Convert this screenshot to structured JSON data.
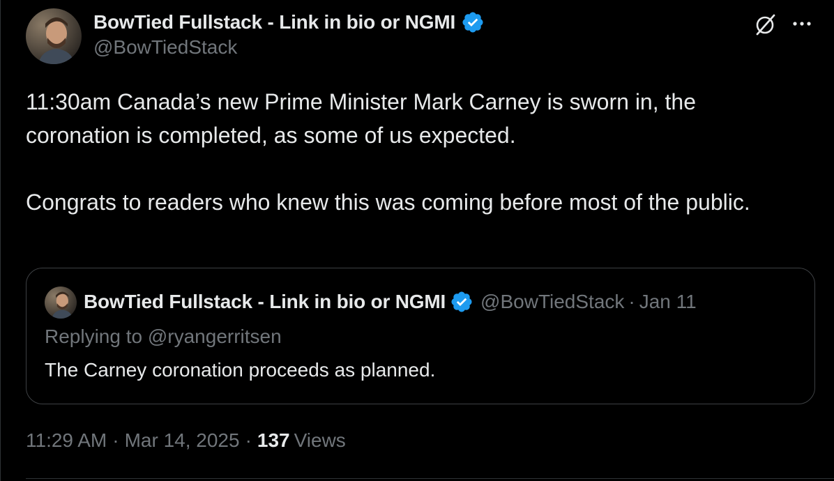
{
  "author": {
    "name": "BowTied Fullstack - Link in bio or NGMI",
    "handle": "@BowTiedStack"
  },
  "tweet": {
    "paragraphs": [
      "11:30am Canada’s new Prime Minister Mark Carney is sworn in, the coronation is completed, as some of us expected.",
      "Congrats to readers who knew this was coming before most of the public."
    ]
  },
  "quoted_tweet": {
    "name": "BowTied Fullstack - Link in bio or NGMI",
    "handle": "@BowTiedStack",
    "separator": "·",
    "date": "Jan 11",
    "replying_to": "Replying to @ryangerritsen",
    "text": "The Carney coronation proceeds as planned."
  },
  "meta": {
    "time": "11:29 AM",
    "date": "Mar 14, 2025",
    "separator": "·",
    "views_count": "137",
    "views_label": "Views"
  },
  "icons": {
    "verified": "verified-badge-icon",
    "grok": "grok-icon",
    "more": "more-options-icon"
  },
  "colors": {
    "background": "#000000",
    "text_primary": "#e7e9ea",
    "text_secondary": "#71767b",
    "verified_blue": "#1d9bf0",
    "border": "#2f3336"
  }
}
